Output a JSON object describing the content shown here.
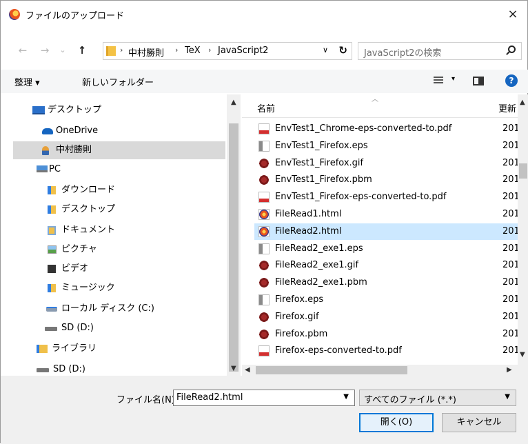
{
  "window": {
    "title": "ファイルのアップロード",
    "close": "×",
    "icon": "firefox-icon"
  },
  "navigation": {
    "back": "←",
    "forward": "→",
    "recent": "⌄",
    "up": "↑",
    "breadcrumbs": [
      "中村勝則",
      "TeX",
      "JavaScript2"
    ],
    "separator": "›",
    "dropdown": "∨",
    "refresh": "↻"
  },
  "search": {
    "placeholder": "JavaScript2の検索"
  },
  "toolbar": {
    "organize": "整理 ▾",
    "new_folder": "新しいフォルダー",
    "view_dd": "▾",
    "help": "?"
  },
  "sidebar": {
    "items": [
      {
        "label": "デスクトップ",
        "icon": "desktop-icon"
      },
      {
        "label": "OneDrive",
        "icon": "onedrive-icon"
      },
      {
        "label": "中村勝則",
        "icon": "user-icon"
      },
      {
        "label": "PC",
        "icon": "pc-icon"
      },
      {
        "label": "ダウンロード",
        "icon": "downloads-icon"
      },
      {
        "label": "デスクトップ",
        "icon": "desktop-folder-icon"
      },
      {
        "label": "ドキュメント",
        "icon": "documents-icon"
      },
      {
        "label": "ピクチャ",
        "icon": "pictures-icon"
      },
      {
        "label": "ビデオ",
        "icon": "videos-icon"
      },
      {
        "label": "ミュージック",
        "icon": "music-icon"
      },
      {
        "label": "ローカル ディスク (C:)",
        "icon": "local-disk-icon"
      },
      {
        "label": "SD (D:)",
        "icon": "sd-drive-icon"
      },
      {
        "label": "ライブラリ",
        "icon": "library-icon"
      },
      {
        "label": "SD (D:)",
        "icon": "sd-drive-icon"
      }
    ],
    "selected_index": 2
  },
  "file_list": {
    "columns": {
      "name": "名前",
      "date": "更新"
    },
    "files": [
      {
        "name": "EnvTest1_Chrome-eps-converted-to.pdf",
        "date": "201",
        "icon": "pdf-icon"
      },
      {
        "name": "EnvTest1_Firefox.eps",
        "date": "201",
        "icon": "eps-icon"
      },
      {
        "name": "EnvTest1_Firefox.gif",
        "date": "201",
        "icon": "gif-icon"
      },
      {
        "name": "EnvTest1_Firefox.pbm",
        "date": "201",
        "icon": "pbm-icon"
      },
      {
        "name": "EnvTest1_Firefox-eps-converted-to.pdf",
        "date": "201",
        "icon": "pdf-icon"
      },
      {
        "name": "FileRead1.html",
        "date": "201",
        "icon": "html-icon"
      },
      {
        "name": "FileRead2.html",
        "date": "201",
        "icon": "html-icon"
      },
      {
        "name": "FileRead2_exe1.eps",
        "date": "201",
        "icon": "eps-icon"
      },
      {
        "name": "FileRead2_exe1.gif",
        "date": "201",
        "icon": "gif-icon"
      },
      {
        "name": "FileRead2_exe1.pbm",
        "date": "201",
        "icon": "pbm-icon"
      },
      {
        "name": "Firefox.eps",
        "date": "201",
        "icon": "eps-icon"
      },
      {
        "name": "Firefox.gif",
        "date": "201",
        "icon": "gif-icon"
      },
      {
        "name": "Firefox.pbm",
        "date": "201",
        "icon": "pbm-icon"
      },
      {
        "name": "Firefox-eps-converted-to.pdf",
        "date": "201",
        "icon": "pdf-icon"
      }
    ],
    "selected_index": 6
  },
  "footer": {
    "filename_label": "ファイル名(N):",
    "filename_value": "FileRead2.html",
    "filter_value": "すべてのファイル (*.*)",
    "open": "開く(O)",
    "cancel": "キャンセル"
  },
  "colors": {
    "selection": "#cce8ff",
    "nav_selection": "#d9d9d9",
    "accent": "#0078d7"
  }
}
